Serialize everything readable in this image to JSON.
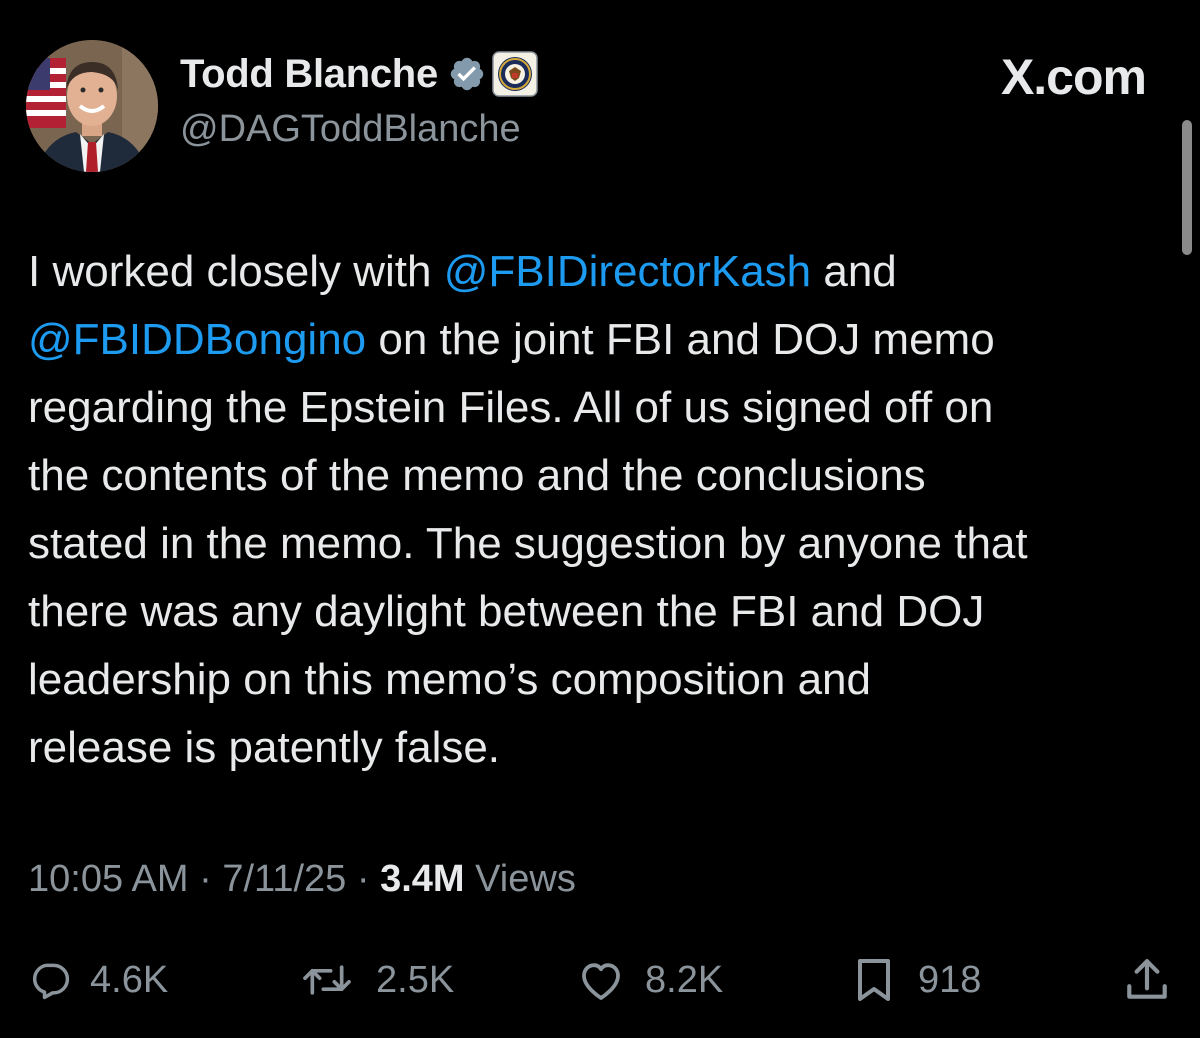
{
  "author": {
    "display_name": "Todd Blanche",
    "handle": "@DAGToddBlanche",
    "verified_icon": "verified-badge-icon",
    "affiliate_icon": "doj-seal-icon"
  },
  "site_mark": "X.com",
  "tweet": {
    "lines": [
      [
        {
          "text": "I worked closely with "
        },
        {
          "text": "@FBIDirectorKash",
          "mention": true
        },
        {
          "text": " and"
        }
      ],
      [
        {
          "text": "@FBIDDBongino",
          "mention": true
        },
        {
          "text": " on the joint FBI and DOJ memo"
        }
      ],
      [
        {
          "text": "regarding the Epstein Files. All of us signed off on"
        }
      ],
      [
        {
          "text": "the contents of the memo and the conclusions"
        }
      ],
      [
        {
          "text": "stated in the memo. The suggestion by anyone that"
        }
      ],
      [
        {
          "text": "there was any daylight between the FBI and DOJ"
        }
      ],
      [
        {
          "text": "leadership on this memo’s composition and"
        }
      ],
      [
        {
          "text": "release is patently false."
        }
      ]
    ]
  },
  "meta": {
    "time": "10:05 AM",
    "separator": " · ",
    "date": "7/11/25",
    "views_count": "3.4M",
    "views_label": " Views"
  },
  "actions": {
    "replies": "4.6K",
    "reposts": "2.5K",
    "likes": "8.2K",
    "bookmarks": "918"
  },
  "colors": {
    "background": "#000000",
    "text": "#e7e9ea",
    "secondary": "#8b949b",
    "mention": "#1d9bf0"
  }
}
